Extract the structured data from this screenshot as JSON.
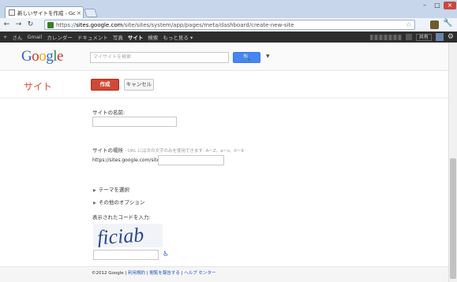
{
  "browser": {
    "tab_title": "新しいサイトを作成 - Google",
    "url_prefix": "https://",
    "url_host": "sites.google.com",
    "url_path": "/site/sites/system/app/pages/meta/dashboard/create-new-site"
  },
  "gbar": {
    "items": [
      "+",
      "さん",
      "Gmail",
      "カレンダー",
      "ドキュメント",
      "写真",
      "サイト",
      "検索",
      "もっと見る ▾"
    ],
    "selected": "サイト",
    "share_label": "共有"
  },
  "search": {
    "logo": "Google",
    "placeholder": "マイサイトを検索"
  },
  "actions": {
    "app_title": "サイト",
    "create_label": "作成",
    "cancel_label": "キャンセル"
  },
  "form": {
    "site_name_label": "サイトの名前:",
    "site_location_label": "サイトの場所",
    "site_location_hint": "- URL には次の文字のみを使用できます: A～Z、a～z、0～9",
    "url_prefix_label": "https://sites.google.com/site/",
    "theme_link": "テーマを選択",
    "options_link": "その他のオプション",
    "captcha_label": "表示されたコードを入力:",
    "captcha_text": "ficiab"
  },
  "footer": {
    "copyright": "©2012 Google |",
    "terms": "利用規約",
    "sep1": "|",
    "report": "閲覧を報告する",
    "sep2": "|",
    "help": "ヘルプ センター"
  }
}
